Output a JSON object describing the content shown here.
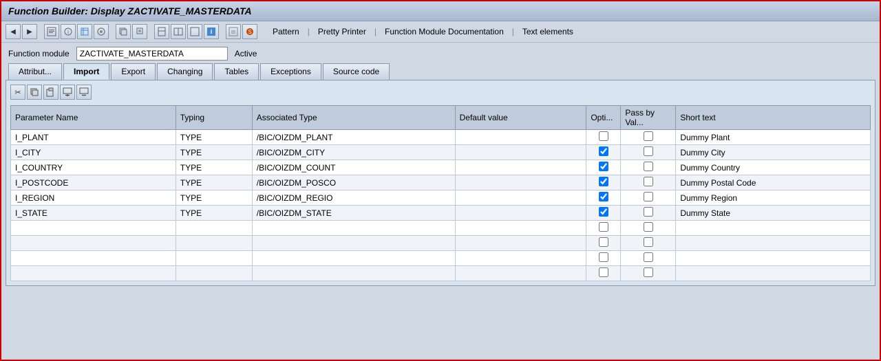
{
  "window": {
    "title": "Function Builder: Display ZACTIVATE_MASTERDATA",
    "border_color": "#cc0000"
  },
  "toolbar": {
    "nav_back_label": "◀",
    "nav_fwd_label": "▶",
    "links": [
      {
        "id": "pattern",
        "label": "Pattern"
      },
      {
        "id": "pretty-printer",
        "label": "Pretty Printer"
      },
      {
        "id": "function-module-doc",
        "label": "Function Module Documentation"
      },
      {
        "id": "text-elements",
        "label": "Text elements"
      }
    ]
  },
  "form": {
    "label": "Function module",
    "value": "ZACTIVATE_MASTERDATA",
    "status": "Active"
  },
  "tabs": [
    {
      "id": "attributes",
      "label": "Attribut..."
    },
    {
      "id": "import",
      "label": "Import",
      "active": true
    },
    {
      "id": "export",
      "label": "Export"
    },
    {
      "id": "changing",
      "label": "Changing"
    },
    {
      "id": "tables",
      "label": "Tables"
    },
    {
      "id": "exceptions",
      "label": "Exceptions"
    },
    {
      "id": "source-code",
      "label": "Source code"
    }
  ],
  "table": {
    "columns": [
      {
        "id": "param-name",
        "label": "Parameter Name"
      },
      {
        "id": "typing",
        "label": "Typing"
      },
      {
        "id": "associated-type",
        "label": "Associated Type"
      },
      {
        "id": "default-value",
        "label": "Default value"
      },
      {
        "id": "optional",
        "label": "Opti..."
      },
      {
        "id": "pass-by-val",
        "label": "Pass by Val..."
      },
      {
        "id": "short-text",
        "label": "Short text"
      }
    ],
    "rows": [
      {
        "param": "I_PLANT",
        "typing": "TYPE",
        "assoc_type": "/BIC/OIZDM_PLANT",
        "default": "",
        "optional": false,
        "pass_by_val": false,
        "short_text": "Dummy Plant"
      },
      {
        "param": "I_CITY",
        "typing": "TYPE",
        "assoc_type": "/BIC/OIZDM_CITY",
        "default": "",
        "optional": true,
        "pass_by_val": false,
        "short_text": "Dummy City"
      },
      {
        "param": "I_COUNTRY",
        "typing": "TYPE",
        "assoc_type": "/BIC/OIZDM_COUNT",
        "default": "",
        "optional": true,
        "pass_by_val": false,
        "short_text": "Dummy Country"
      },
      {
        "param": "I_POSTCODE",
        "typing": "TYPE",
        "assoc_type": "/BIC/OIZDM_POSCO",
        "default": "",
        "optional": true,
        "pass_by_val": false,
        "short_text": "Dummy Postal Code"
      },
      {
        "param": "I_REGION",
        "typing": "TYPE",
        "assoc_type": "/BIC/OIZDM_REGIO",
        "default": "",
        "optional": true,
        "pass_by_val": false,
        "short_text": "Dummy Region"
      },
      {
        "param": "I_STATE",
        "typing": "TYPE",
        "assoc_type": "/BIC/OIZDM_STATE",
        "default": "",
        "optional": true,
        "pass_by_val": false,
        "short_text": "Dummy State"
      },
      {
        "param": "",
        "typing": "",
        "assoc_type": "",
        "default": "",
        "optional": false,
        "pass_by_val": false,
        "short_text": ""
      },
      {
        "param": "",
        "typing": "",
        "assoc_type": "",
        "default": "",
        "optional": false,
        "pass_by_val": false,
        "short_text": ""
      },
      {
        "param": "",
        "typing": "",
        "assoc_type": "",
        "default": "",
        "optional": false,
        "pass_by_val": false,
        "short_text": ""
      },
      {
        "param": "",
        "typing": "",
        "assoc_type": "",
        "default": "",
        "optional": false,
        "pass_by_val": false,
        "short_text": ""
      }
    ]
  }
}
